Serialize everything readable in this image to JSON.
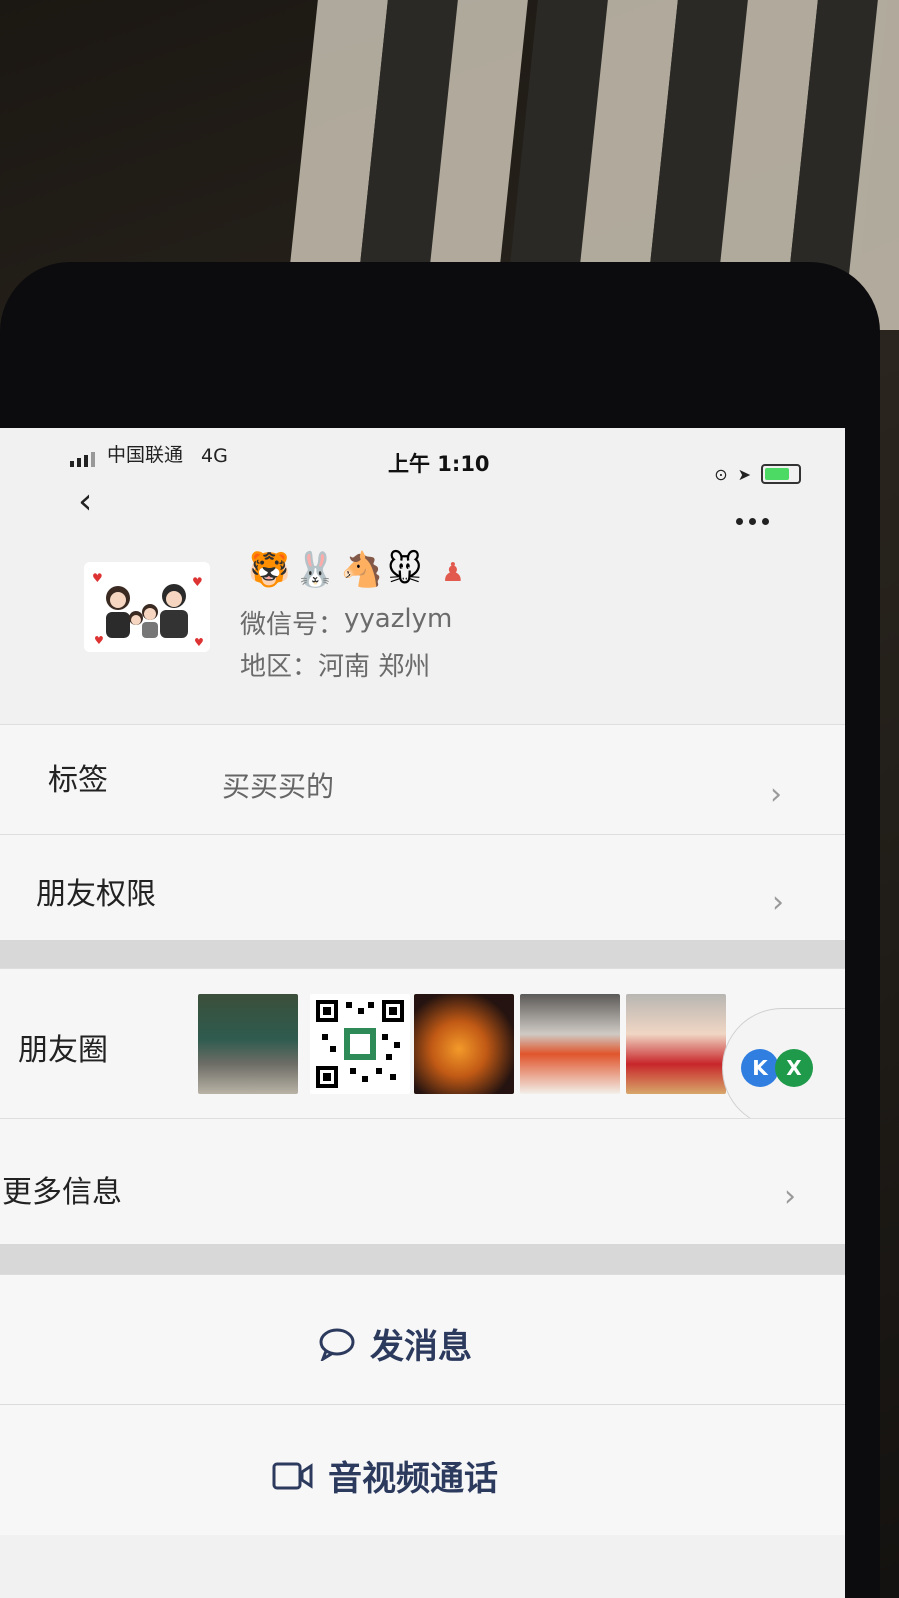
{
  "status_bar": {
    "carrier": "中国联通",
    "network": "4G",
    "time": "上午 1:10"
  },
  "profile": {
    "name_emoji": "🐯🐰🐴🐭",
    "wechat_id_label": "微信号：",
    "wechat_id": "yyazlym",
    "region_label": "地区：",
    "region": "河南 郑州"
  },
  "rows": {
    "tags_label": "标签",
    "tags_value": "买买买的",
    "permissions_label": "朋友权限",
    "moments_label": "朋友圈",
    "more_info_label": "更多信息"
  },
  "actions": {
    "send_message": "发消息",
    "video_call": "音视频通话"
  },
  "floating_bubble": {
    "left_letter": "K",
    "right_letter": "X"
  },
  "colors": {
    "action_text": "#2c3a5e",
    "background": "#f1f1f1"
  }
}
